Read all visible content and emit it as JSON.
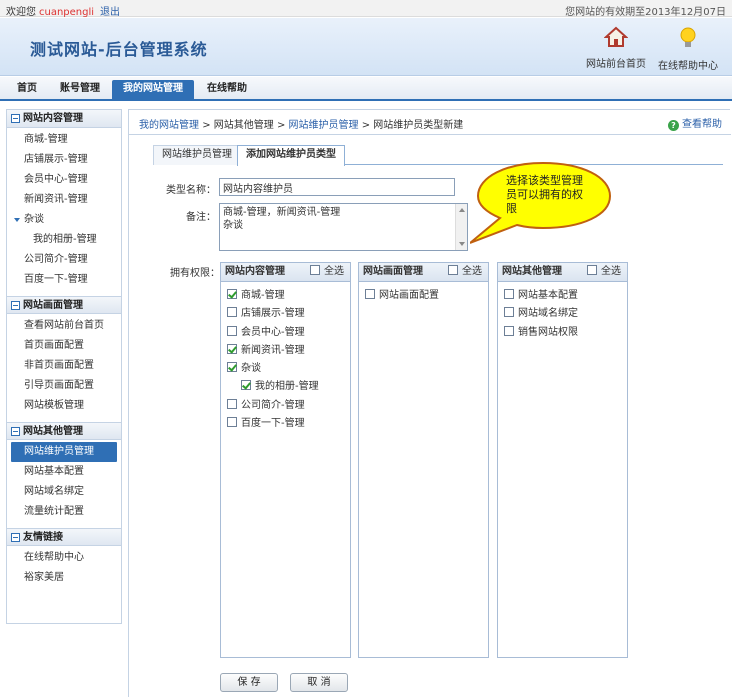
{
  "topbar": {
    "welcome": "欢迎您",
    "username": "cuanpengli",
    "logout": "退出",
    "expiry": "您网站的有效期至2013年12月07日"
  },
  "header": {
    "title": "测试网站-后台管理系统",
    "front_home": "网站前台首页",
    "online_help": "在线帮助中心"
  },
  "nav": {
    "tabs": [
      "首页",
      "账号管理",
      "我的网站管理",
      "在线帮助"
    ],
    "active": "我的网站管理"
  },
  "sidebar": {
    "sections": [
      {
        "title": "网站内容管理",
        "items": [
          "商城-管理",
          "店铺展示-管理",
          "会员中心-管理",
          "新闻资讯-管理",
          "杂谈",
          "我的相册-管理",
          "公司简介-管理",
          "百度一下-管理"
        ]
      },
      {
        "title": "网站画面管理",
        "items": [
          "查看网站前台首页",
          "首页画面配置",
          "非首页画面配置",
          "引导页画面配置",
          "网站模板管理"
        ]
      },
      {
        "title": "网站其他管理",
        "items": [
          "网站维护员管理",
          "网站基本配置",
          "网站域名绑定",
          "流量统计配置"
        ]
      },
      {
        "title": "友情链接",
        "items": [
          "在线帮助中心",
          "裕家美居"
        ]
      }
    ],
    "active_item": "网站维护员管理"
  },
  "breadcrumb": {
    "items": [
      "我的网站管理",
      "网站其他管理",
      "网站维护员管理",
      "网站维护员类型新建"
    ],
    "sep": ">"
  },
  "help_link": "查看帮助",
  "subtabs": [
    "网站维护员管理",
    "添加网站维护员类型"
  ],
  "form": {
    "type_name_label": "类型名称：",
    "type_name_value": "网站内容维护员",
    "remark_label": "备注：",
    "remark_line1": "商城-管理，新闻资讯-管理",
    "remark_line2": "杂谈",
    "permissions_label": "拥有权限："
  },
  "permissions": [
    {
      "title": "网站内容管理",
      "select_all": "全选",
      "items": [
        {
          "label": "商城-管理",
          "checked": true
        },
        {
          "label": "店铺展示-管理",
          "checked": false
        },
        {
          "label": "会员中心-管理",
          "checked": false
        },
        {
          "label": "新闻资讯-管理",
          "checked": true
        },
        {
          "label": "杂谈",
          "checked": true
        },
        {
          "label": "我的相册-管理",
          "checked": true
        },
        {
          "label": "公司简介-管理",
          "checked": false
        },
        {
          "label": "百度一下-管理",
          "checked": false
        }
      ]
    },
    {
      "title": "网站画面管理",
      "select_all": "全选",
      "items": [
        {
          "label": "网站画面配置",
          "checked": false
        }
      ]
    },
    {
      "title": "网站其他管理",
      "select_all": "全选",
      "items": [
        {
          "label": "网站基本配置",
          "checked": false
        },
        {
          "label": "网站域名绑定",
          "checked": false
        },
        {
          "label": "销售网站权限",
          "checked": false
        }
      ]
    }
  ],
  "buttons": {
    "save": "保 存",
    "cancel": "取 消"
  },
  "callout": "选择该类型管理员可以拥有的权限",
  "colors": {
    "accent": "#2f6fb5",
    "callout_fill": "#ffff00",
    "user_name": "#dd3333"
  }
}
